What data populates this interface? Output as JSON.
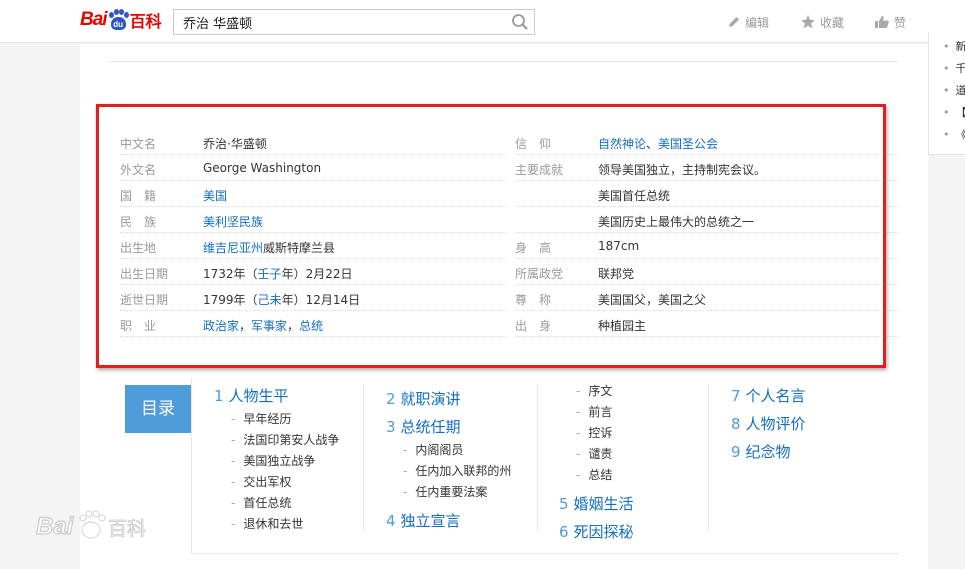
{
  "topbar": {
    "logo_bai": "Bai",
    "logo_du": "du",
    "logo_baike": "百科",
    "search_value": "乔治 华盛顿",
    "actions": [
      {
        "label": "编辑",
        "icon": "edit-icon"
      },
      {
        "label": "收藏",
        "icon": "star-icon"
      },
      {
        "label": "赞",
        "icon": "thumbs-up-icon"
      }
    ]
  },
  "right_panel": {
    "items": [
      "新",
      "千",
      "道",
      "【",
      "《"
    ]
  },
  "infobox": {
    "left": [
      {
        "label": "中文名",
        "value": [
          {
            "t": "乔治·华盛顿"
          }
        ]
      },
      {
        "label": "外文名",
        "value": [
          {
            "t": "George Washington"
          }
        ]
      },
      {
        "label": "国　籍",
        "value": [
          {
            "t": "美国",
            "link": true
          }
        ]
      },
      {
        "label": "民　族",
        "value": [
          {
            "t": "美利坚民族",
            "link": true
          }
        ]
      },
      {
        "label": "出生地",
        "value": [
          {
            "t": "维吉尼亚州",
            "link": true
          },
          {
            "t": "威斯特摩兰县"
          }
        ]
      },
      {
        "label": "出生日期",
        "value": [
          {
            "t": "1732年（"
          },
          {
            "t": "壬子",
            "link": true
          },
          {
            "t": "年）2月22日"
          }
        ]
      },
      {
        "label": "逝世日期",
        "value": [
          {
            "t": "1799年（"
          },
          {
            "t": "己未",
            "link": true
          },
          {
            "t": "年）12月14日"
          }
        ]
      },
      {
        "label": "职　业",
        "value": [
          {
            "t": "政治家",
            "link": true
          },
          {
            "t": "，"
          },
          {
            "t": "军事家",
            "link": true
          },
          {
            "t": "，"
          },
          {
            "t": "总统",
            "link": true
          }
        ]
      }
    ],
    "right": [
      {
        "label": "信　仰",
        "value": [
          {
            "t": "自然神论",
            "link": true
          },
          {
            "t": "、"
          },
          {
            "t": "美国圣公会",
            "link": true
          }
        ]
      },
      {
        "label": "主要成就",
        "value": [
          {
            "t": "领导美国独立，主持制宪会议。"
          }
        ]
      },
      {
        "label": "",
        "value": [
          {
            "t": "美国首任总统"
          }
        ]
      },
      {
        "label": "",
        "value": [
          {
            "t": "美国历史上最伟大的总统之一"
          }
        ]
      },
      {
        "label": "身　高",
        "value": [
          {
            "t": "187cm"
          }
        ]
      },
      {
        "label": "所属政党",
        "value": [
          {
            "t": "联邦党"
          }
        ]
      },
      {
        "label": "尊　称",
        "value": [
          {
            "t": "美国国父，美国之父"
          }
        ]
      },
      {
        "label": "出　身",
        "value": [
          {
            "t": "种植园主"
          }
        ]
      }
    ]
  },
  "catalog": {
    "button_label": "目录",
    "col1": {
      "title_num": "1",
      "title": "人物生平",
      "subs": [
        "早年经历",
        "法国印第安人战争",
        "美国独立战争",
        "交出军权",
        "首任总统",
        "退休和去世"
      ]
    },
    "col2": {
      "sections": [
        {
          "num": "2",
          "title": "就职演讲",
          "subs": []
        },
        {
          "num": "3",
          "title": "总统任期",
          "subs": [
            "内阁阁员",
            "任内加入联邦的州",
            "任内重要法案"
          ]
        },
        {
          "num": "4",
          "title": "独立宣言",
          "subs": []
        }
      ]
    },
    "col3": {
      "subs": [
        "序文",
        "前言",
        "控诉",
        "谴责",
        "总结"
      ],
      "sections": [
        {
          "num": "5",
          "title": "婚姻生活"
        },
        {
          "num": "6",
          "title": "死因探秘"
        }
      ]
    },
    "col4": {
      "sections": [
        {
          "num": "7",
          "title": "个人名言"
        },
        {
          "num": "8",
          "title": "人物评价"
        },
        {
          "num": "9",
          "title": "纪念物"
        }
      ]
    }
  },
  "watermark": {
    "text": "Bai百科"
  }
}
